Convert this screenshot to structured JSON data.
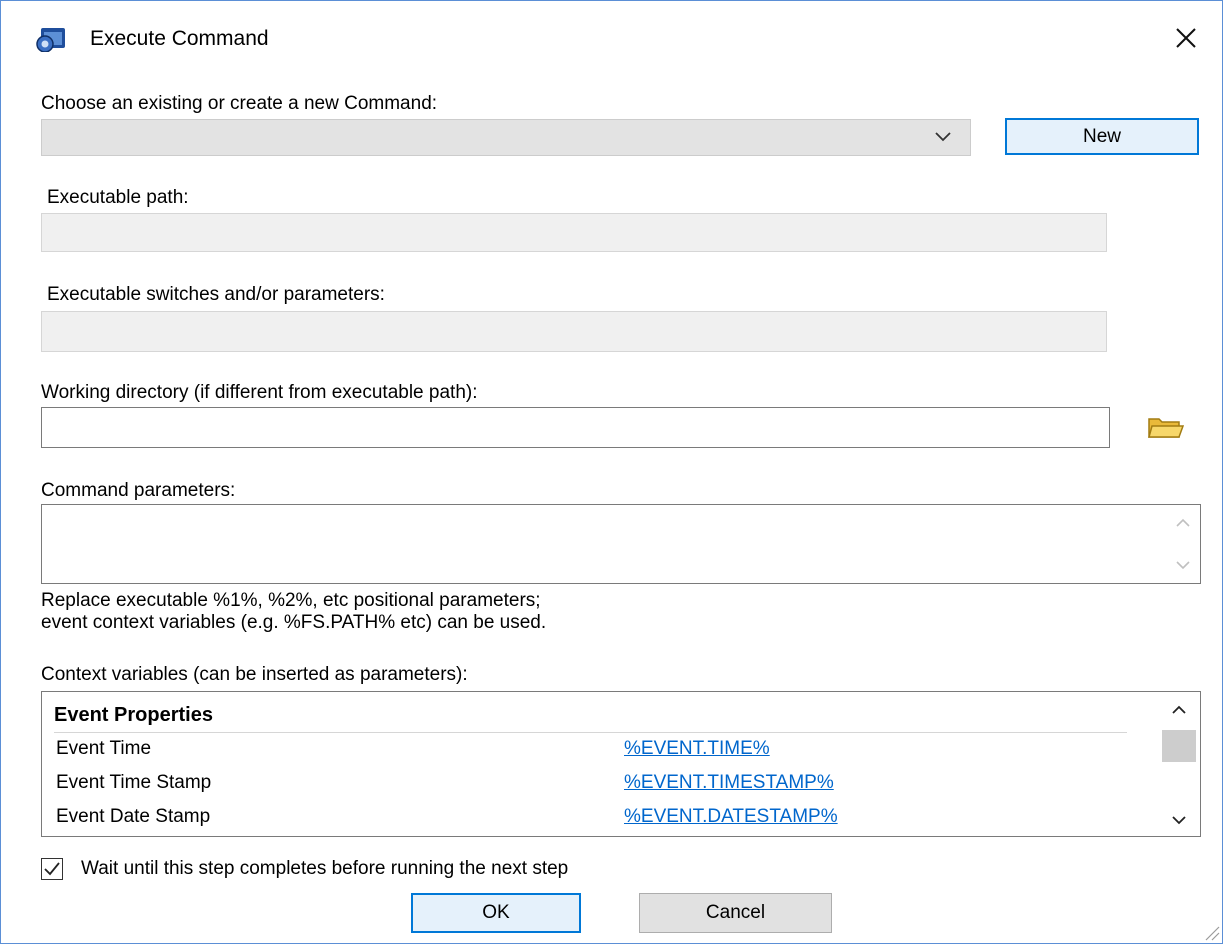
{
  "window": {
    "title": "Execute Command",
    "icon": "execute-command-app-icon",
    "close_icon": "close-icon"
  },
  "command_select": {
    "label": "Choose an existing or create a new Command:",
    "value": "",
    "new_button": "New"
  },
  "executable_path": {
    "label": "Executable path:",
    "value": ""
  },
  "executable_switches": {
    "label": "Executable switches and/or parameters:",
    "value": ""
  },
  "working_directory": {
    "label": "Working directory (if different from executable path):",
    "value": "",
    "browse_icon": "folder-icon"
  },
  "command_parameters": {
    "label": "Command parameters:",
    "value": "",
    "help_line1": "Replace executable %1%, %2%, etc positional parameters;",
    "help_line2": "event context variables (e.g. %FS.PATH% etc) can be used."
  },
  "context_variables": {
    "label": "Context variables (can be inserted as parameters):",
    "group_header": "Event Properties",
    "rows": [
      {
        "name": "Event Time",
        "variable": "%EVENT.TIME%"
      },
      {
        "name": "Event Time Stamp",
        "variable": "%EVENT.TIMESTAMP%"
      },
      {
        "name": "Event Date Stamp",
        "variable": "%EVENT.DATESTAMP%"
      }
    ]
  },
  "wait_checkbox": {
    "label": "Wait until this step completes before running the next step",
    "checked": true
  },
  "buttons": {
    "ok": "OK",
    "cancel": "Cancel"
  },
  "colors": {
    "accent": "#0078d7",
    "link": "#0066cc",
    "window_border": "#5b8fd6"
  }
}
